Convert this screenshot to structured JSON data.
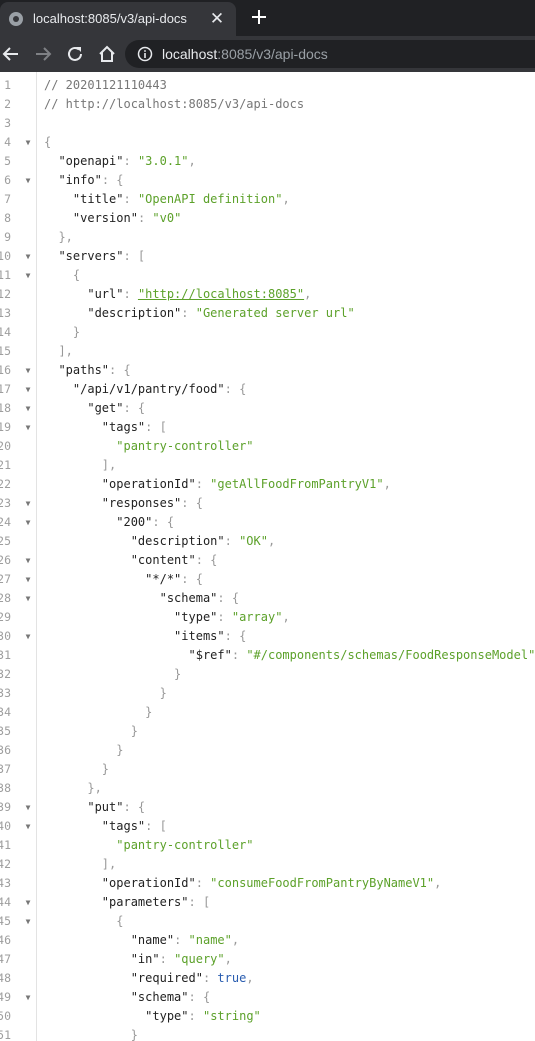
{
  "browser": {
    "tab_title": "localhost:8085/v3/api-docs",
    "tab_close_glyph": "✕",
    "url_host": "localhost",
    "url_rest": ":8085/v3/api-docs",
    "icons": [
      "globe-icon",
      "close-icon",
      "plus-icon",
      "back-arrow-icon",
      "forward-arrow-icon",
      "reload-icon",
      "home-icon",
      "info-icon"
    ]
  },
  "code_lines": [
    {
      "n": "1",
      "f": false,
      "ind": 0,
      "t": [
        [
          "c",
          "// 20201121110443"
        ]
      ]
    },
    {
      "n": "2",
      "f": false,
      "ind": 0,
      "t": [
        [
          "c",
          "// http://localhost:8085/v3/api-docs"
        ]
      ]
    },
    {
      "n": "3",
      "f": false,
      "ind": 0,
      "t": []
    },
    {
      "n": "4",
      "f": true,
      "ind": 0,
      "t": [
        [
          "p",
          "{"
        ]
      ]
    },
    {
      "n": "5",
      "f": false,
      "ind": 1,
      "t": [
        [
          "k",
          "\"openapi\""
        ],
        [
          "p",
          ": "
        ],
        [
          "s",
          "\"3.0.1\""
        ],
        [
          "p",
          ","
        ]
      ]
    },
    {
      "n": "6",
      "f": true,
      "ind": 1,
      "t": [
        [
          "k",
          "\"info\""
        ],
        [
          "p",
          ": {"
        ]
      ]
    },
    {
      "n": "7",
      "f": false,
      "ind": 2,
      "t": [
        [
          "k",
          "\"title\""
        ],
        [
          "p",
          ": "
        ],
        [
          "s",
          "\"OpenAPI definition\""
        ],
        [
          "p",
          ","
        ]
      ]
    },
    {
      "n": "8",
      "f": false,
      "ind": 2,
      "t": [
        [
          "k",
          "\"version\""
        ],
        [
          "p",
          ": "
        ],
        [
          "s",
          "\"v0\""
        ]
      ]
    },
    {
      "n": "9",
      "f": false,
      "ind": 1,
      "t": [
        [
          "p",
          "},"
        ]
      ]
    },
    {
      "n": "10",
      "f": true,
      "ind": 1,
      "t": [
        [
          "k",
          "\"servers\""
        ],
        [
          "p",
          ": ["
        ]
      ]
    },
    {
      "n": "11",
      "f": true,
      "ind": 2,
      "t": [
        [
          "p",
          "{"
        ]
      ]
    },
    {
      "n": "12",
      "f": false,
      "ind": 3,
      "t": [
        [
          "k",
          "\"url\""
        ],
        [
          "p",
          ": "
        ],
        [
          "l",
          "\"http://localhost:8085\""
        ],
        [
          "p",
          ","
        ]
      ]
    },
    {
      "n": "13",
      "f": false,
      "ind": 3,
      "t": [
        [
          "k",
          "\"description\""
        ],
        [
          "p",
          ": "
        ],
        [
          "s",
          "\"Generated server url\""
        ]
      ]
    },
    {
      "n": "14",
      "f": false,
      "ind": 2,
      "t": [
        [
          "p",
          "}"
        ]
      ]
    },
    {
      "n": "15",
      "f": false,
      "ind": 1,
      "t": [
        [
          "p",
          "],"
        ]
      ]
    },
    {
      "n": "16",
      "f": true,
      "ind": 1,
      "t": [
        [
          "k",
          "\"paths\""
        ],
        [
          "p",
          ": {"
        ]
      ]
    },
    {
      "n": "17",
      "f": true,
      "ind": 2,
      "t": [
        [
          "k",
          "\"/api/v1/pantry/food\""
        ],
        [
          "p",
          ": {"
        ]
      ]
    },
    {
      "n": "18",
      "f": true,
      "ind": 3,
      "t": [
        [
          "k",
          "\"get\""
        ],
        [
          "p",
          ": {"
        ]
      ]
    },
    {
      "n": "19",
      "f": true,
      "ind": 4,
      "t": [
        [
          "k",
          "\"tags\""
        ],
        [
          "p",
          ": ["
        ]
      ]
    },
    {
      "n": "20",
      "f": false,
      "ind": 5,
      "t": [
        [
          "s",
          "\"pantry-controller\""
        ]
      ]
    },
    {
      "n": "21",
      "f": false,
      "ind": 4,
      "t": [
        [
          "p",
          "],"
        ]
      ]
    },
    {
      "n": "22",
      "f": false,
      "ind": 4,
      "t": [
        [
          "k",
          "\"operationId\""
        ],
        [
          "p",
          ": "
        ],
        [
          "s",
          "\"getAllFoodFromPantryV1\""
        ],
        [
          "p",
          ","
        ]
      ]
    },
    {
      "n": "23",
      "f": true,
      "ind": 4,
      "t": [
        [
          "k",
          "\"responses\""
        ],
        [
          "p",
          ": {"
        ]
      ]
    },
    {
      "n": "24",
      "f": true,
      "ind": 5,
      "t": [
        [
          "k",
          "\"200\""
        ],
        [
          "p",
          ": {"
        ]
      ]
    },
    {
      "n": "25",
      "f": false,
      "ind": 6,
      "t": [
        [
          "k",
          "\"description\""
        ],
        [
          "p",
          ": "
        ],
        [
          "s",
          "\"OK\""
        ],
        [
          "p",
          ","
        ]
      ]
    },
    {
      "n": "26",
      "f": true,
      "ind": 6,
      "t": [
        [
          "k",
          "\"content\""
        ],
        [
          "p",
          ": {"
        ]
      ]
    },
    {
      "n": "27",
      "f": true,
      "ind": 7,
      "t": [
        [
          "k",
          "\"*/*\""
        ],
        [
          "p",
          ": {"
        ]
      ]
    },
    {
      "n": "28",
      "f": true,
      "ind": 8,
      "t": [
        [
          "k",
          "\"schema\""
        ],
        [
          "p",
          ": {"
        ]
      ]
    },
    {
      "n": "29",
      "f": false,
      "ind": 9,
      "t": [
        [
          "k",
          "\"type\""
        ],
        [
          "p",
          ": "
        ],
        [
          "s",
          "\"array\""
        ],
        [
          "p",
          ","
        ]
      ]
    },
    {
      "n": "30",
      "f": true,
      "ind": 9,
      "t": [
        [
          "k",
          "\"items\""
        ],
        [
          "p",
          ": {"
        ]
      ]
    },
    {
      "n": "31",
      "f": false,
      "ind": 10,
      "t": [
        [
          "k",
          "\"$ref\""
        ],
        [
          "p",
          ": "
        ],
        [
          "s",
          "\"#/components/schemas/FoodResponseModel\""
        ]
      ]
    },
    {
      "n": "32",
      "f": false,
      "ind": 9,
      "t": [
        [
          "p",
          "}"
        ]
      ]
    },
    {
      "n": "33",
      "f": false,
      "ind": 8,
      "t": [
        [
          "p",
          "}"
        ]
      ]
    },
    {
      "n": "34",
      "f": false,
      "ind": 7,
      "t": [
        [
          "p",
          "}"
        ]
      ]
    },
    {
      "n": "35",
      "f": false,
      "ind": 6,
      "t": [
        [
          "p",
          "}"
        ]
      ]
    },
    {
      "n": "36",
      "f": false,
      "ind": 5,
      "t": [
        [
          "p",
          "}"
        ]
      ]
    },
    {
      "n": "37",
      "f": false,
      "ind": 4,
      "t": [
        [
          "p",
          "}"
        ]
      ]
    },
    {
      "n": "38",
      "f": false,
      "ind": 3,
      "t": [
        [
          "p",
          "},"
        ]
      ]
    },
    {
      "n": "39",
      "f": true,
      "ind": 3,
      "t": [
        [
          "k",
          "\"put\""
        ],
        [
          "p",
          ": {"
        ]
      ]
    },
    {
      "n": "40",
      "f": true,
      "ind": 4,
      "t": [
        [
          "k",
          "\"tags\""
        ],
        [
          "p",
          ": ["
        ]
      ]
    },
    {
      "n": "41",
      "f": false,
      "ind": 5,
      "t": [
        [
          "s",
          "\"pantry-controller\""
        ]
      ]
    },
    {
      "n": "42",
      "f": false,
      "ind": 4,
      "t": [
        [
          "p",
          "],"
        ]
      ]
    },
    {
      "n": "43",
      "f": false,
      "ind": 4,
      "t": [
        [
          "k",
          "\"operationId\""
        ],
        [
          "p",
          ": "
        ],
        [
          "s",
          "\"consumeFoodFromPantryByNameV1\""
        ],
        [
          "p",
          ","
        ]
      ]
    },
    {
      "n": "44",
      "f": true,
      "ind": 4,
      "t": [
        [
          "k",
          "\"parameters\""
        ],
        [
          "p",
          ": ["
        ]
      ]
    },
    {
      "n": "45",
      "f": true,
      "ind": 5,
      "t": [
        [
          "p",
          "{"
        ]
      ]
    },
    {
      "n": "46",
      "f": false,
      "ind": 6,
      "t": [
        [
          "k",
          "\"name\""
        ],
        [
          "p",
          ": "
        ],
        [
          "s",
          "\"name\""
        ],
        [
          "p",
          ","
        ]
      ]
    },
    {
      "n": "47",
      "f": false,
      "ind": 6,
      "t": [
        [
          "k",
          "\"in\""
        ],
        [
          "p",
          ": "
        ],
        [
          "s",
          "\"query\""
        ],
        [
          "p",
          ","
        ]
      ]
    },
    {
      "n": "48",
      "f": false,
      "ind": 6,
      "t": [
        [
          "k",
          "\"required\""
        ],
        [
          "p",
          ": "
        ],
        [
          "b",
          "true"
        ],
        [
          "p",
          ","
        ]
      ]
    },
    {
      "n": "49",
      "f": true,
      "ind": 6,
      "t": [
        [
          "k",
          "\"schema\""
        ],
        [
          "p",
          ": {"
        ]
      ]
    },
    {
      "n": "50",
      "f": false,
      "ind": 7,
      "t": [
        [
          "k",
          "\"type\""
        ],
        [
          "p",
          ": "
        ],
        [
          "s",
          "\"string\""
        ]
      ]
    },
    {
      "n": "51",
      "f": false,
      "ind": 6,
      "t": [
        [
          "p",
          "}"
        ]
      ]
    }
  ]
}
